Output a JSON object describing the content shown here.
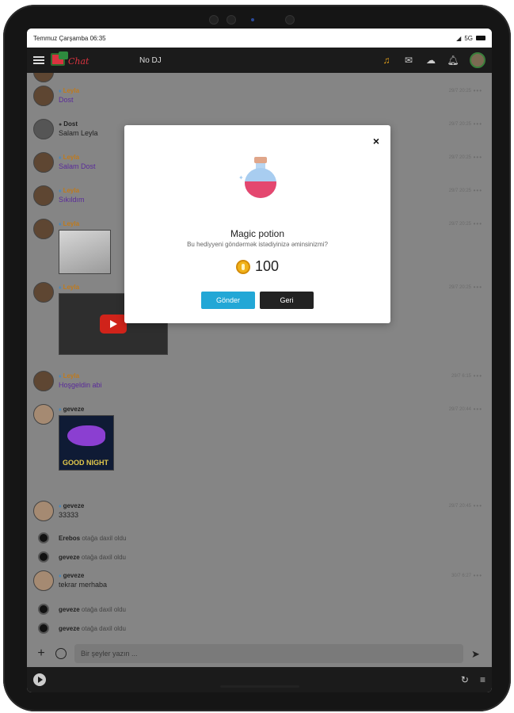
{
  "status_bar": {
    "datetime": "Temmuz Çarşamba 06:35",
    "network": "5G"
  },
  "header": {
    "logo_text": "Chat",
    "dj_label": "No DJ"
  },
  "messages": [
    {
      "user": "Leyla",
      "text": "Dost",
      "time": "29/7 20:25"
    },
    {
      "user": "Dost",
      "text": "Salam Leyla",
      "time": "29/7 20:25"
    },
    {
      "user": "Leyla",
      "text": "Salam Dost",
      "time": "29/7 20:25"
    },
    {
      "user": "Leyla",
      "text": "Sıkıldım",
      "time": "29/7 20:25"
    },
    {
      "user": "Leyla",
      "time": "29/7 20:25"
    },
    {
      "user": "Leyla",
      "time": "29/7 20:25"
    },
    {
      "user": "Leyla",
      "text": "Hoşgeldin abi",
      "time": "29/7 6:15"
    },
    {
      "user": "geveze",
      "image_text": "GOOD NIGHT",
      "time": "29/7 20:44"
    },
    {
      "user": "geveze",
      "text": "33333",
      "time": "29/7 20:45"
    },
    {
      "user": "geveze",
      "text": "tekrar merhaba",
      "time": "30/7 6:27"
    }
  ],
  "system": [
    {
      "name": "Erebos",
      "action": "otağa daxil oldu"
    },
    {
      "name": "geveze",
      "action": "otağa daxil oldu"
    },
    {
      "name": "geveze",
      "action": "otağa daxil oldu"
    },
    {
      "name": "geveze",
      "action": "otağa daxil oldu"
    }
  ],
  "compose": {
    "placeholder": "Bir şeyler yazın ..."
  },
  "modal": {
    "title": "Magic potion",
    "subtitle": "Bu hediyyeni göndərmək istədiyinizə əminsinizmi?",
    "price": "100",
    "send_label": "Gönder",
    "back_label": "Geri",
    "close_label": "×"
  },
  "colors": {
    "accent": "#22a7d6",
    "user_gold": "#c07a1b",
    "message_purple": "#5a2b9a",
    "header_bg": "#1b1b1b"
  }
}
